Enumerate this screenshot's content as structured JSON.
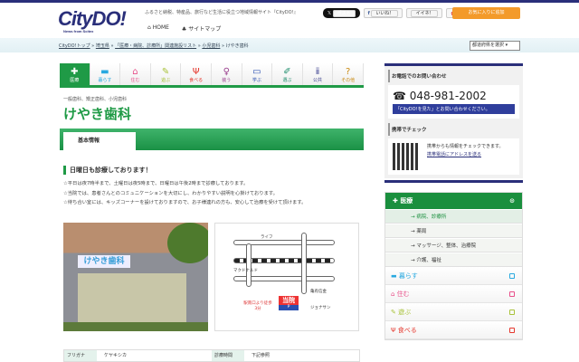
{
  "header": {
    "logo": "CityDO!",
    "logo_sub": "News from Scitex",
    "tagline": "ふるさと納税、特産品、旅行など生活に役立つ地域情報サイト『CityDO!』",
    "nav": [
      "HOME",
      "サイトマップ"
    ],
    "social": [
      "ポスト",
      "いいね！",
      "イイネ！",
      "+1"
    ],
    "favorite": "お気に入りに追加",
    "pref_select": "都道府県を選択"
  },
  "breadcrumb": [
    "CityDO!トップ",
    "埼玉県",
    "「医療・病院、診療所」関連施設リスト",
    "小児歯科",
    "けやき歯科"
  ],
  "categories": [
    {
      "label": "医療",
      "icon": "✚"
    },
    {
      "label": "暮らす",
      "icon": "▬"
    },
    {
      "label": "住む",
      "icon": "⌂"
    },
    {
      "label": "遊ぶ",
      "icon": "✎"
    },
    {
      "label": "食べる",
      "icon": "Ψ"
    },
    {
      "label": "装う",
      "icon": "♀"
    },
    {
      "label": "学ぶ",
      "icon": "▭"
    },
    {
      "label": "選ぶ",
      "icon": "✐"
    },
    {
      "label": "公共",
      "icon": "ⅱ"
    },
    {
      "label": "その他",
      "icon": "?"
    }
  ],
  "page": {
    "subtitle": "一般歯科、矯正歯科、小児歯科",
    "title": "けやき歯科",
    "tab": "基本情報",
    "heading": "日曜日も診療しております！",
    "desc": [
      "☆平日は夜7時半まで、土曜日は夜5時まで、日曜日は午後2時まで診療しております。",
      "☆当院では、患者さんとのコミュニケーションを大切にし、わかりやすい説明を心掛けております。",
      "☆待ち合い室には、キッズコーナーを設けておりますので、お子様連れの方も、安心して治療を受けて頂けます。"
    ],
    "photo_sign": "けやき歯科",
    "map_labels": [
      "ライフ",
      "マクドナルド",
      "亀有信金",
      "ジョナサン",
      "駅南口より徒歩3分",
      "当院",
      "P"
    ],
    "info": [
      {
        "key": "フリガナ",
        "value": "ケヤキシカ"
      },
      {
        "key": "診療時間",
        "value": "下記参照"
      }
    ]
  },
  "sidebar": {
    "phone_heading": "お電話でのお問い合わせ",
    "phone": "048-981-2002",
    "phone_note": "「CityDO!を見た」とお問い合わせください。",
    "mobile_heading": "携帯でチェック",
    "mobile_text": "携帯からも情報をチェックできます。",
    "mobile_link": "携帯電話にアドレスを送る",
    "menu_head": "医療",
    "menu_items": [
      "病院、診療所",
      "薬局",
      "マッサージ、整体、治療院",
      "介護、福祉"
    ],
    "menu_cats": [
      {
        "label": "暮らす",
        "color": "#29a9e0"
      },
      {
        "label": "住む",
        "color": "#e8508a"
      },
      {
        "label": "遊ぶ",
        "color": "#a9c23b"
      },
      {
        "label": "食べる",
        "color": "#e5382e"
      }
    ]
  },
  "colors": {
    "brand": "#2a2f7a",
    "accent": "#1f9a46",
    "favorite": "#f39a2a"
  }
}
